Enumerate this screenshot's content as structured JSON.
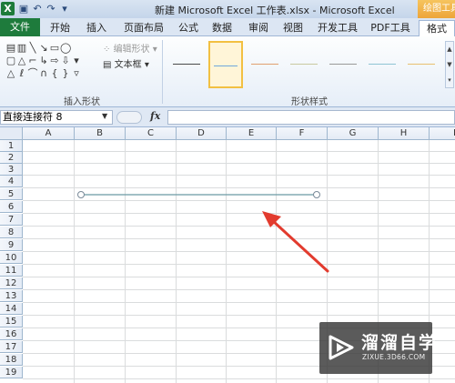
{
  "window": {
    "title": "新建 Microsoft Excel 工作表.xlsx - Microsoft Excel",
    "context_tab_title": "绘图工具",
    "qat_icons": [
      "save-icon",
      "undo-icon",
      "redo-icon",
      "customize-icon"
    ]
  },
  "tabs": [
    "文件",
    "开始",
    "插入",
    "页面布局",
    "公式",
    "数据",
    "审阅",
    "视图",
    "开发工具",
    "PDF工具",
    "格式"
  ],
  "active_tab": "格式",
  "ribbon": {
    "insert_shapes": {
      "label": "插入形状",
      "edit_shape": "编辑形状",
      "text_box": "文本框"
    },
    "shape_styles": {
      "label": "形状样式",
      "line_colors": [
        "#4a4a4a",
        "#6fa8dc",
        "#e0a070",
        "#c9c9a0",
        "#999999",
        "#8fc4d4",
        "#e8c070"
      ]
    }
  },
  "formula_bar": {
    "name_box": "直接连接符 8",
    "fx_label": "fx",
    "value": ""
  },
  "sheet": {
    "columns": [
      "A",
      "B",
      "C",
      "D",
      "E",
      "F",
      "G",
      "H",
      "I"
    ],
    "rows": [
      "1",
      "2",
      "3",
      "4",
      "5",
      "6",
      "7",
      "8",
      "9",
      "10",
      "11",
      "12",
      "13",
      "14",
      "15",
      "16",
      "17",
      "18",
      "19"
    ]
  },
  "watermark": {
    "brand": "溜溜自学",
    "url": "ZIXUE.3D66.COM"
  },
  "colors": {
    "file_tab": "#1e7b3c",
    "context_tab": "#eda53a",
    "connector_line": "#6a9aa5",
    "annotation_arrow": "#e23b2e"
  }
}
